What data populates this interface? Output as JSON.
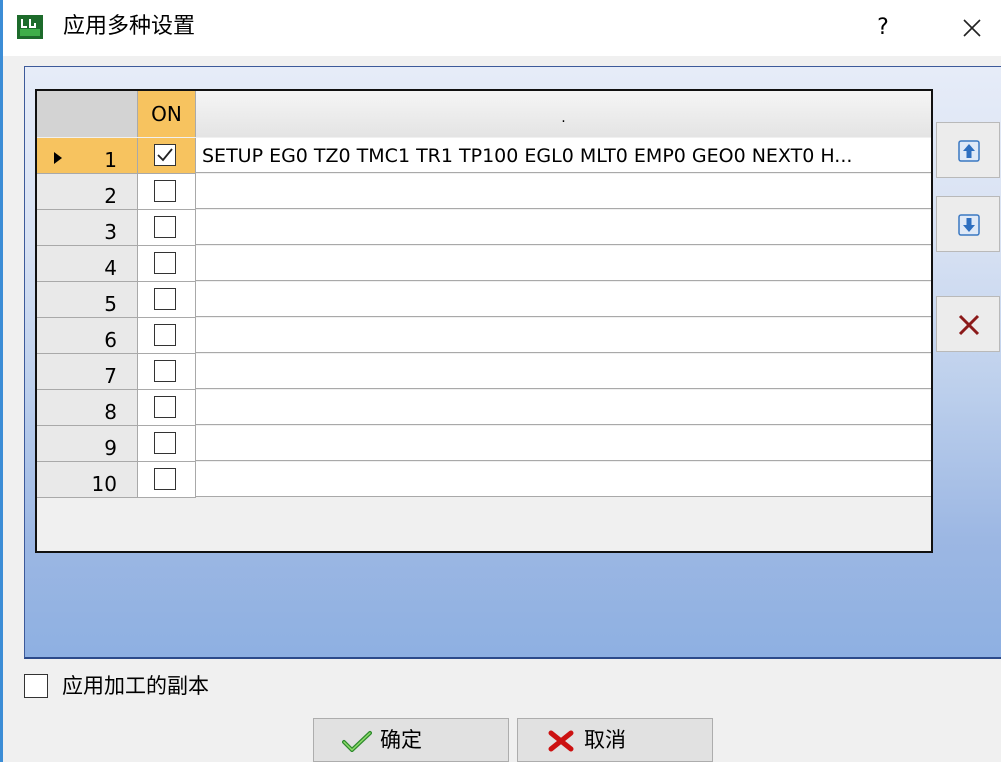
{
  "window": {
    "title": "应用多种设置",
    "help_label": "?",
    "icon": "app-logo-icon",
    "close_icon": "close-icon"
  },
  "grid": {
    "columns": {
      "row_header": "",
      "on": "ON",
      "description": "."
    },
    "rows": [
      {
        "num": "1",
        "checked": true,
        "text": "SETUP EG0 TZ0 TMC1 TR1 TP100 EGL0 MLT0 EMP0 GEO0 NEXT0 H...",
        "current": true
      },
      {
        "num": "2",
        "checked": false,
        "text": ""
      },
      {
        "num": "3",
        "checked": false,
        "text": ""
      },
      {
        "num": "4",
        "checked": false,
        "text": ""
      },
      {
        "num": "5",
        "checked": false,
        "text": ""
      },
      {
        "num": "6",
        "checked": false,
        "text": ""
      },
      {
        "num": "7",
        "checked": false,
        "text": ""
      },
      {
        "num": "8",
        "checked": false,
        "text": ""
      },
      {
        "num": "9",
        "checked": false,
        "text": ""
      },
      {
        "num": "10",
        "checked": false,
        "text": ""
      }
    ]
  },
  "side_buttons": [
    {
      "name": "move-up-button",
      "icon": "arrow-up-icon"
    },
    {
      "name": "move-down-button",
      "icon": "arrow-down-icon"
    },
    {
      "name": "delete-button",
      "icon": "delete-x-icon"
    }
  ],
  "options": {
    "apply_copy_label": "应用加工的副本",
    "apply_copy_checked": false
  },
  "buttons": {
    "ok_label": "确定",
    "cancel_label": "取消"
  },
  "colors": {
    "selection": "#f7c35f",
    "panel_gradient_bottom": "#8eb0e2",
    "check_icon": "#2e8b2e",
    "cancel_icon": "#cc1111"
  }
}
